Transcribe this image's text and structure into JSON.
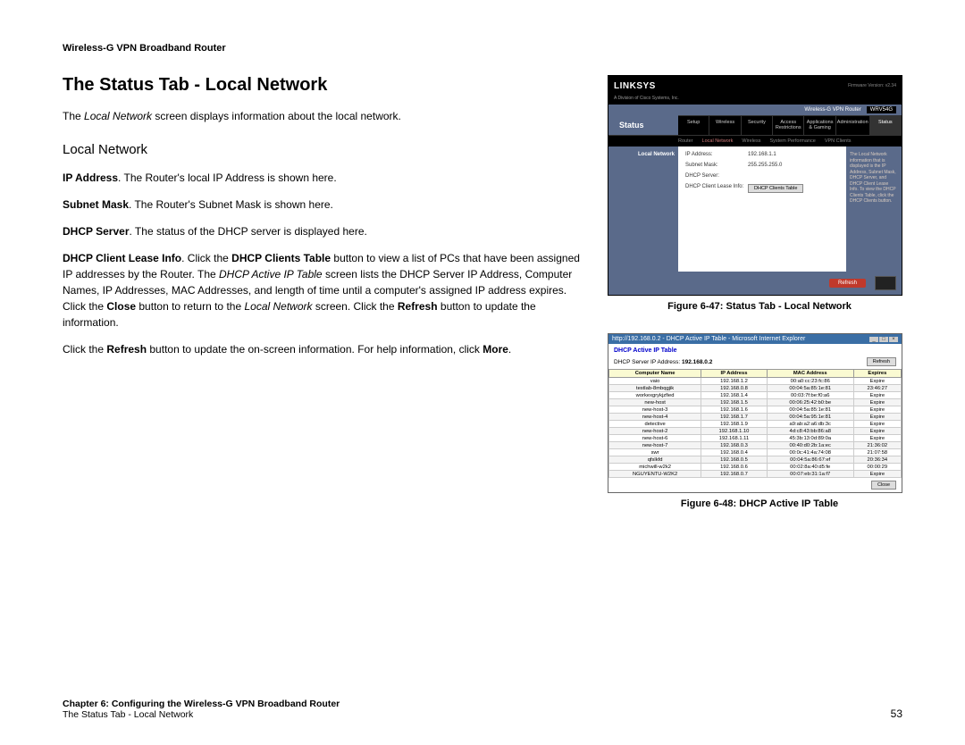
{
  "header": {
    "product": "Wireless-G VPN Broadband Router"
  },
  "title": "The Status Tab - Local Network",
  "intro_pre": "The ",
  "intro_ital": "Local Network",
  "intro_post": " screen displays information about the local network.",
  "subtitle": "Local Network",
  "p1_b": "IP Address",
  "p1_t": ". The Router's local IP Address is shown here.",
  "p2_b": "Subnet Mask",
  "p2_t": ". The Router's Subnet Mask is shown here.",
  "p3_b": "DHCP Server",
  "p3_t": ". The status of the DHCP server is displayed here.",
  "p4_b1": "DHCP Client Lease Info",
  "p4_t1": ". Click the ",
  "p4_b2": "DHCP Clients Table",
  "p4_t2": " button to view a list of PCs that have been assigned IP addresses by the Router. The ",
  "p4_i1": "DHCP Active IP Table",
  "p4_t3": " screen lists the DHCP Server IP Address, Computer Names, IP Addresses, MAC Addresses, and length of time until a computer's assigned IP address expires. Click the ",
  "p4_b3": "Close",
  "p4_t4": " button to return to the ",
  "p4_i2": "Local Network",
  "p4_t5": " screen. Click the ",
  "p4_b4": "Refresh",
  "p4_t6": " button to update the information.",
  "p5_t1": "Click the ",
  "p5_b1": "Refresh",
  "p5_t2": " button to update the on-screen information. For help information, click ",
  "p5_b2": "More",
  "p5_t3": ".",
  "fig1": {
    "caption": "Figure 6-47: Status Tab - Local Network",
    "brand": "LINKSYS",
    "brand_sub": "A Division of Cisco Systems, Inc.",
    "fw": "Firmware Version: v2.34",
    "title_left": "Status",
    "model_label": "Wireless-G VPN Router",
    "model": "WRV54G",
    "tabs": [
      "Setup",
      "Wireless",
      "Security",
      "Access Restrictions",
      "Applications & Gaming",
      "Administration",
      "Status"
    ],
    "subtabs": [
      "Router",
      "Local Network",
      "Wireless",
      "System Performance",
      "VPN Clients"
    ],
    "panel_label": "Local Network",
    "rows": {
      "ip_lbl": "IP Address:",
      "ip_val": "192.168.1.1",
      "sm_lbl": "Subnet Mask:",
      "sm_val": "255.255.255.0",
      "ds_lbl": "DHCP Server:",
      "cl_lbl": "DHCP Client Lease Info:",
      "cl_btn": "DHCP Clients Table"
    },
    "help": "The Local Network information that is displayed is the IP Address, Subnet Mask, DHCP Server, and DHCP Client Lease Info. To view the DHCP Clients Table, click the DHCP Clients button.",
    "refresh": "Refresh"
  },
  "fig2": {
    "caption": "Figure 6-48: DHCP Active IP Table",
    "ie_title": "http://192.168.0.2 - DHCP Active IP Table - Microsoft Internet Explorer",
    "heading": "DHCP Active IP Table",
    "srv_lbl": "DHCP Server IP Address:",
    "srv_val": "192.168.0.2",
    "refresh": "Refresh",
    "cols": [
      "Computer Name",
      "IP Address",
      "MAC Address",
      "Expires"
    ],
    "rows": [
      [
        "vaio",
        "192.168.1.2",
        "00:a0:cc:23:fc:86",
        "Expire"
      ],
      [
        "testlab-8mbqgjik",
        "192.168.0.8",
        "00:04:5a:85:1e:81",
        "23:46:27"
      ],
      [
        "workexgrykjzfied",
        "192.168.1.4",
        "00:03:7f:be:f0:a6",
        "Expire"
      ],
      [
        "new-host",
        "192.168.1.5",
        "00:06:25:42:b0:be",
        "Expire"
      ],
      [
        "new-host-3",
        "192.168.1.6",
        "00:04:5a:85:1e:81",
        "Expire"
      ],
      [
        "new-host-4",
        "192.168.1.7",
        "00:04:5a:95:1e:81",
        "Expire"
      ],
      [
        "detective",
        "192.168.1.9",
        "a9:ab:a2:a6:db:3c",
        "Expire"
      ],
      [
        "new-host-2",
        "192.168.1.10",
        "4d:c8:43:bb:86:a8",
        "Expire"
      ],
      [
        "new-host-6",
        "192.168.1.11",
        "45:3b:13:0d:89:0a",
        "Expire"
      ],
      [
        "new-host-7",
        "192.168.0.3",
        "00:40:d0:2b:1a:ec",
        "21:36:02"
      ],
      [
        "swr",
        "192.168.0.4",
        "00:0c:41:4a:74:08",
        "21:07:58"
      ],
      [
        "qfslkfd",
        "192.168.0.5",
        "00:04:5a:86:67:ef",
        "20:36:34"
      ],
      [
        "michwill-w2k2",
        "192.168.0.6",
        "00:02:8a:40:d5:fe",
        "00:00:29"
      ],
      [
        "NGUYENTU-W2K2",
        "192.168.0.7",
        "00:07:eb:31:1a:f7",
        "Expire"
      ]
    ],
    "close": "Close"
  },
  "footer": {
    "chapter": "Chapter 6: Configuring the Wireless-G VPN Broadband Router",
    "section": "The Status Tab - Local Network",
    "page": "53"
  }
}
